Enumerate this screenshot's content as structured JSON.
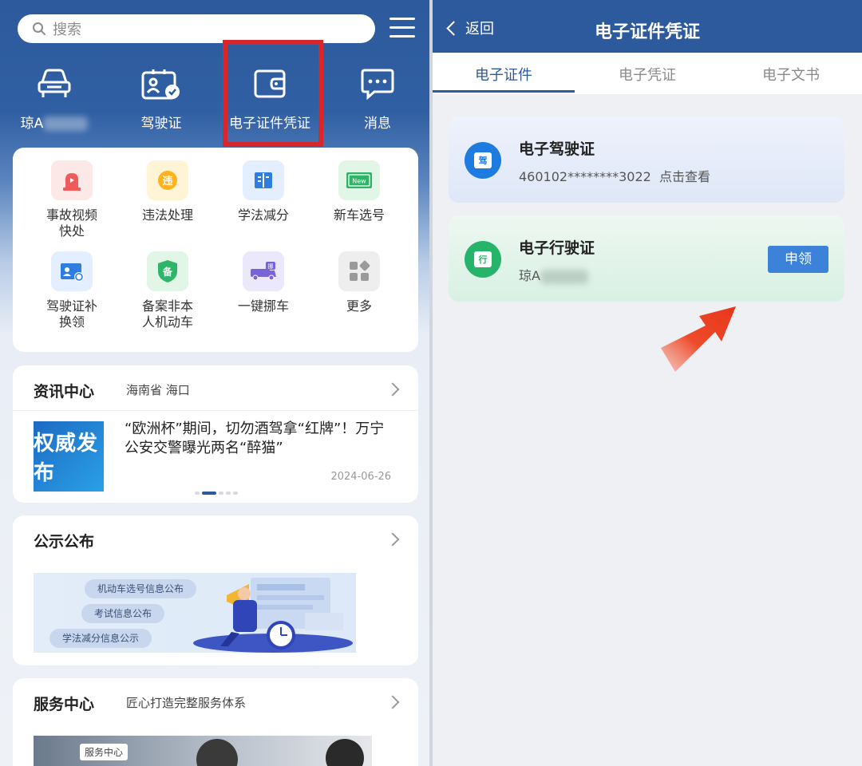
{
  "left": {
    "search": {
      "placeholder": "搜索"
    },
    "top_nav": [
      {
        "label": "琼A",
        "icon": "car-icon"
      },
      {
        "label": "驾驶证",
        "icon": "license-icon"
      },
      {
        "label": "电子证件凭证",
        "icon": "wallet-icon"
      },
      {
        "label": "消息",
        "icon": "message-icon"
      }
    ],
    "services": [
      {
        "label": "事故视频\n快处",
        "color": "#fde8e8"
      },
      {
        "label": "违法处理",
        "color": "#fff4d6",
        "glyph": "违"
      },
      {
        "label": "学法减分",
        "color": "#e3efff"
      },
      {
        "label": "新车选号",
        "color": "#e1f6e6",
        "glyph": "New"
      },
      {
        "label": "驾驶证补\n换领",
        "color": "#e3efff"
      },
      {
        "label": "备案非本\n人机动车",
        "color": "#e1f6e6",
        "glyph": "备"
      },
      {
        "label": "一键挪车",
        "color": "#ece8fb",
        "glyph": "挪"
      },
      {
        "label": "更多",
        "color": "#eeeeee"
      }
    ],
    "news": {
      "title": "资讯中心",
      "location": "海南省 海口",
      "image_text": "权威发布",
      "headline": "“欧洲杯”期间，切勿酒驾拿“红牌”！万宁公安交警曝光两名“醉猫”",
      "date": "2024-06-26"
    },
    "publish": {
      "title": "公示公布",
      "pills": [
        "机动车选号信息公布",
        "考试信息公布",
        "学法减分信息公示"
      ]
    },
    "service_center": {
      "title": "服务中心",
      "subtitle": "匠心打造完整服务体系",
      "tag": "服务中心"
    }
  },
  "right": {
    "back_label": "返回",
    "title": "电子证件凭证",
    "tabs": [
      "电子证件",
      "电子凭证",
      "电子文书"
    ],
    "certs": [
      {
        "title": "电子驾驶证",
        "subtitle": "460102********3022  点击查看",
        "glyph": "驾",
        "color": "#1e7be0"
      },
      {
        "title": "电子行驶证",
        "subtitle": "琼A",
        "glyph": "行",
        "color": "#25b46a",
        "button": "申领"
      }
    ]
  },
  "colors": {
    "brand_blue": "#2d5a9c",
    "highlight_red": "#d8272a",
    "arrow_red": "#ec3b1f"
  }
}
